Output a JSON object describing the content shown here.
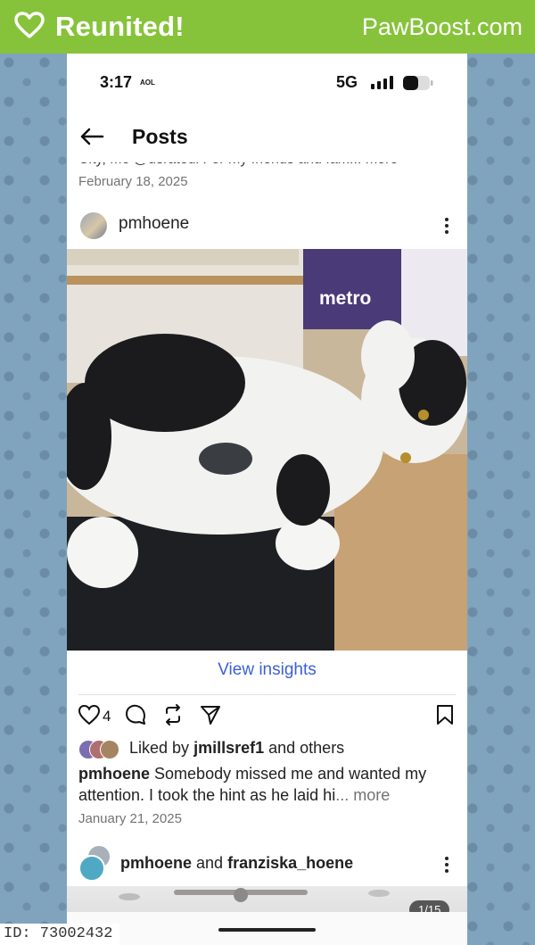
{
  "banner": {
    "title": "Reunited!",
    "brand": "PawBoost.com",
    "icon": "heart-outline-icon",
    "color": "#86c33a"
  },
  "status_bar": {
    "time": "3:17",
    "carrier": "AOL",
    "network": "5G"
  },
  "nav": {
    "title": "Posts",
    "back_icon": "arrow-left-icon"
  },
  "previous_post": {
    "caption_fragment": "City, Mo @usratedl For my friends and fam... more",
    "date": "February 18, 2025"
  },
  "post": {
    "username": "pmhoene",
    "image_description": "black-and-white cat",
    "insights_label": "View insights",
    "likes_count": "4",
    "liked_by_prefix": "Liked by",
    "liked_by_user": "jmillsref1",
    "liked_by_suffix": "and others",
    "caption_user": "pmhoene",
    "caption_text": "Somebody missed me and wanted my attention.  I took the hint as he laid hi",
    "caption_more": "... more",
    "date": "January 21, 2025"
  },
  "next_post": {
    "user1": "pmhoene",
    "joiner": "and",
    "user2": "franziska_hoene",
    "page_indicator": "1/15"
  },
  "footer": {
    "id_label": "ID: 73002432"
  }
}
